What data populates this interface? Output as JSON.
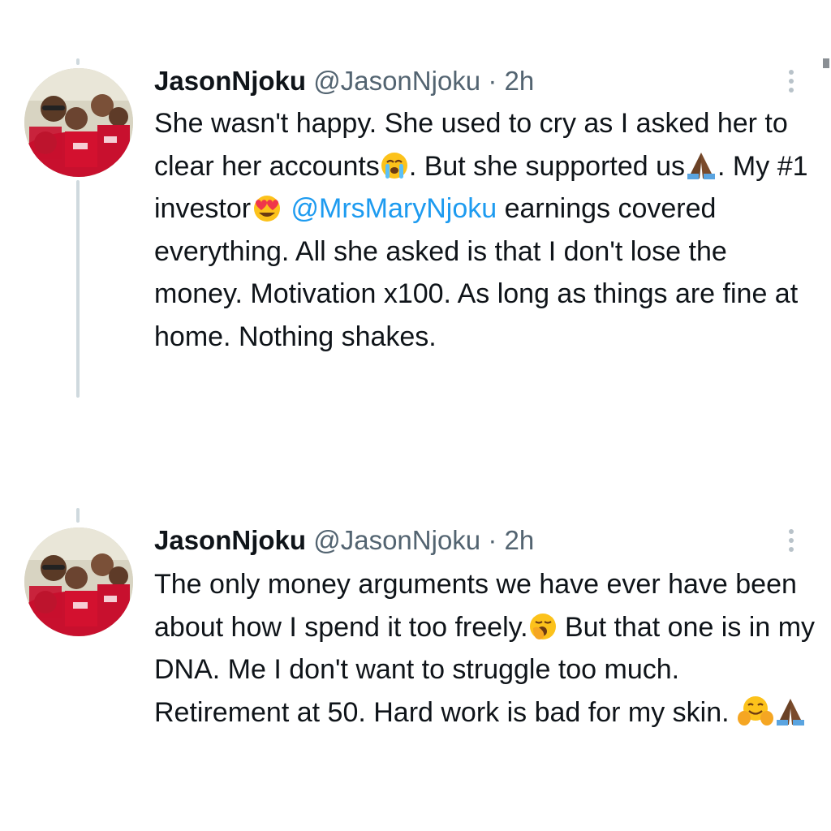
{
  "tweets": [
    {
      "display_name": "JasonNjoku",
      "handle": "@JasonNjoku",
      "separator": "·",
      "time": "2h",
      "more_icon": "more-vertical-icon",
      "text_parts": {
        "p1": "She wasn't happy. She used to cry as I asked her to clear her accounts",
        "p2": ". But she supported us",
        "p3": ". My #1 investor",
        "mention": "@MrsMaryNjoku",
        "p4": " earnings covered everything. All she asked is that I don't lose the money. Motivation x100. As long as things are fine at home. Nothing shakes."
      },
      "emojis": [
        "loudly-crying-face-icon",
        "folded-hands-icon",
        "heart-eyes-icon"
      ]
    },
    {
      "display_name": "JasonNjoku",
      "handle": "@JasonNjoku",
      "separator": "·",
      "time": "2h",
      "more_icon": "more-vertical-icon",
      "text_parts": {
        "p1": "The only money arguments we have ever have been about how I spend it too freely.",
        "p2": "But that one is in my DNA. Me I don't want to struggle too much. Retirement at 50. Hard work is bad for my skin. "
      },
      "emojis": [
        "yawning-face-icon",
        "hugging-face-icon",
        "folded-hands-icon"
      ]
    }
  ],
  "colors": {
    "text": "#0f1419",
    "secondary": "#536471",
    "mention": "#1d9bf0",
    "thread_line": "#cfd9de"
  }
}
